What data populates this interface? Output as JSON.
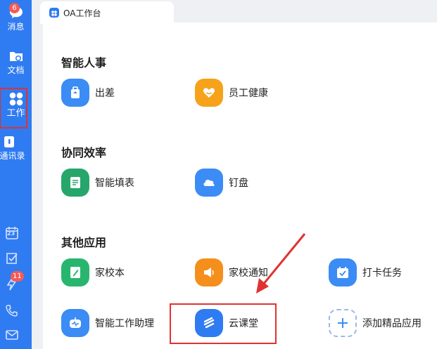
{
  "sidebar": {
    "messages": {
      "label": "消息",
      "badge": "6"
    },
    "docs": {
      "label": "文档"
    },
    "work": {
      "label": "工作"
    },
    "contacts": {
      "label": "通讯录"
    },
    "tools": [
      {
        "icon": "calendar-icon",
        "text": "23"
      },
      {
        "icon": "todo-check-icon"
      },
      {
        "icon": "ding-lightning-icon",
        "badge": "11"
      },
      {
        "icon": "phone-icon"
      },
      {
        "icon": "mail-icon"
      }
    ]
  },
  "tab": {
    "title": "OA工作台"
  },
  "sections": [
    {
      "title": "智能人事",
      "apps": [
        {
          "label": "出差",
          "icon": "suitcase-icon",
          "color": "#3b8cf5"
        },
        {
          "label": "员工健康",
          "icon": "heart-icon",
          "color": "#f7a21b"
        }
      ]
    },
    {
      "title": "协同效率",
      "apps": [
        {
          "label": "智能填表",
          "icon": "form-icon",
          "color": "#26a66b"
        },
        {
          "label": "钉盘",
          "icon": "cloud-icon",
          "color": "#3b8cf5"
        }
      ]
    },
    {
      "title": "其他应用",
      "apps": [
        {
          "label": "家校本",
          "icon": "notebook-pen-icon",
          "color": "#28b66f"
        },
        {
          "label": "家校通知",
          "icon": "megaphone-icon",
          "color": "#f58f1b"
        },
        {
          "label": "打卡任务",
          "icon": "calendar-check-icon",
          "color": "#3b8cf5"
        },
        {
          "label": "智能工作助理",
          "icon": "robot-icon",
          "color": "#3b8cf5"
        },
        {
          "label": "云课堂",
          "icon": "cloud-class-icon",
          "color": "#2f7bf2"
        },
        {
          "label": "添加精品应用",
          "icon": "plus-icon",
          "color": "#3b8cf5"
        }
      ]
    }
  ],
  "colors": {
    "sidebar": "#2f7bf2",
    "highlight": "#e03232"
  }
}
